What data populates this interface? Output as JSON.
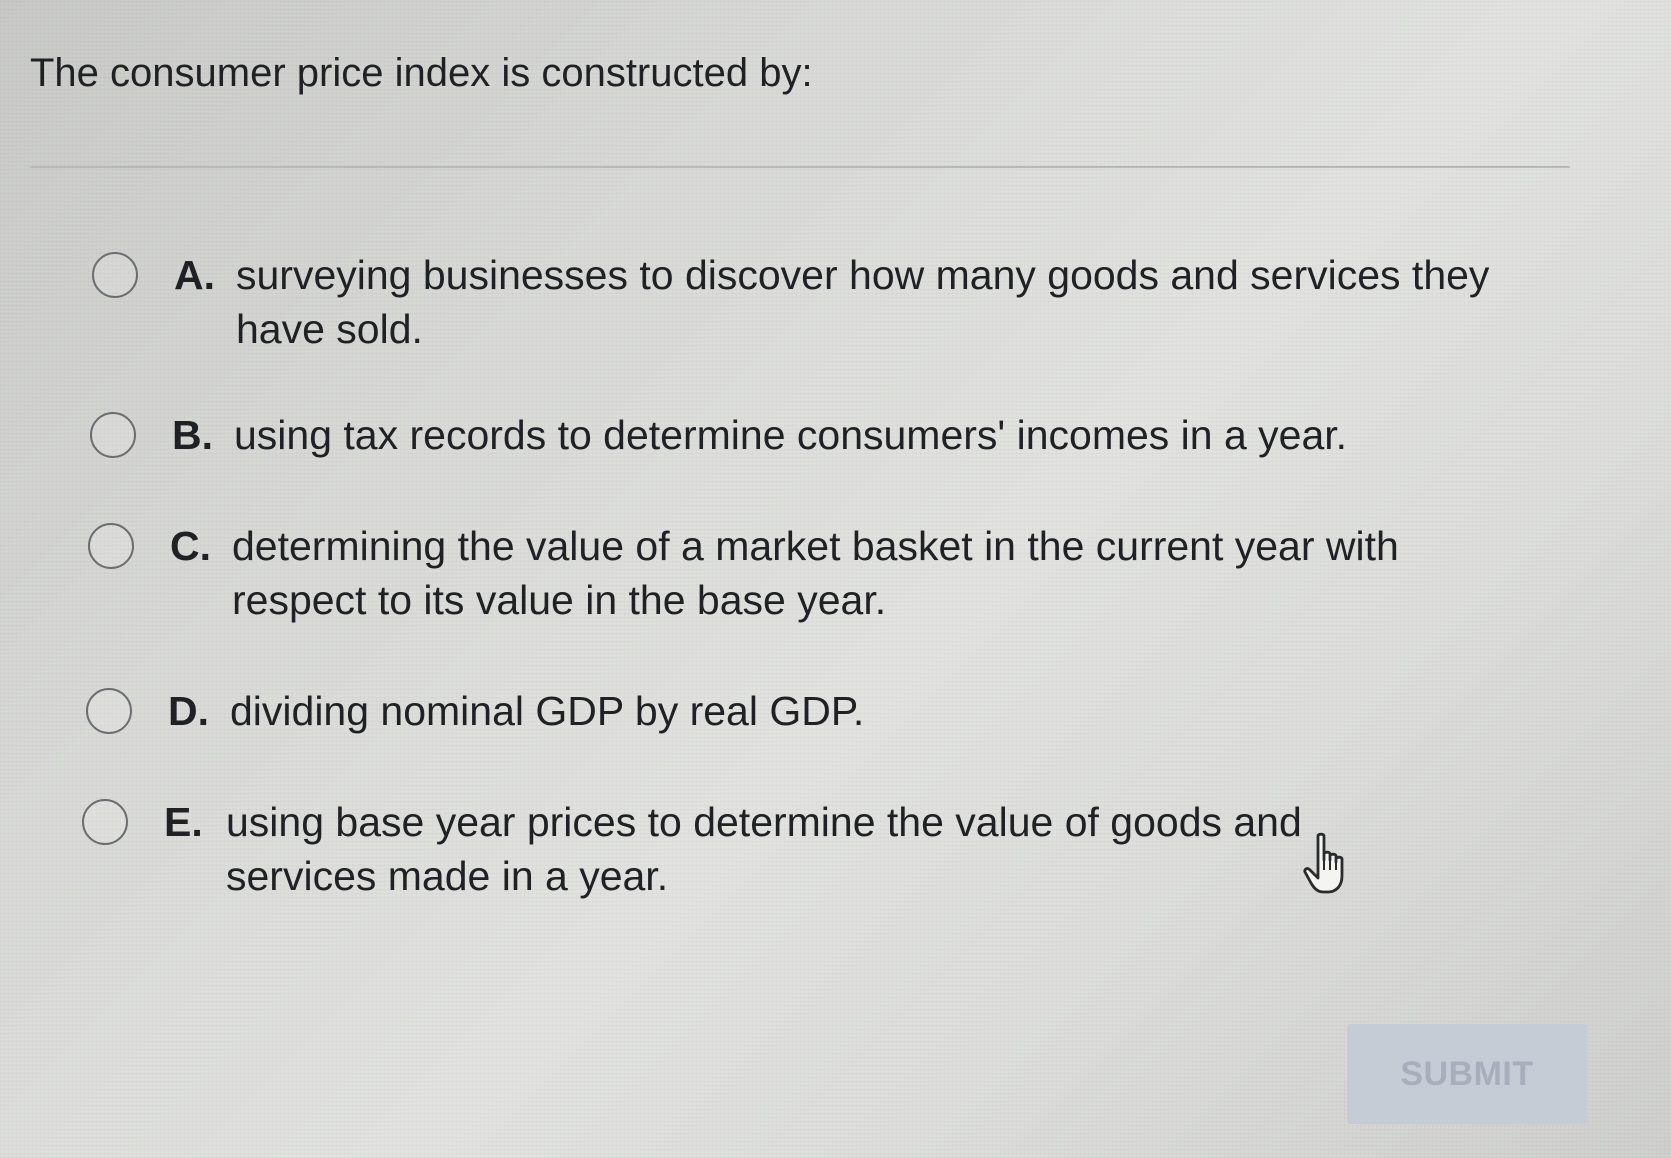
{
  "question": {
    "text": "The consumer price index is constructed by:"
  },
  "options": [
    {
      "letter": "A.",
      "text": "surveying businesses to discover how many goods and services they have sold."
    },
    {
      "letter": "B.",
      "text": "using tax records to determine consumers' incomes in a year."
    },
    {
      "letter": "C.",
      "text": "determining the value of a market basket in the current year with respect to its value in the base year."
    },
    {
      "letter": "D.",
      "text": "dividing nominal GDP by real GDP."
    },
    {
      "letter": "E.",
      "text": "using base year prices to determine the value of goods and services made in a year."
    }
  ],
  "submit": {
    "label": "SUBMIT",
    "state": "disabled"
  },
  "cursor": {
    "icon": "hand-pointer-icon"
  },
  "colors": {
    "text": "#1f2124",
    "radio_border": "#6b6d70",
    "submit_bg": "#c6ccd6",
    "submit_text": "#a7afbc"
  }
}
